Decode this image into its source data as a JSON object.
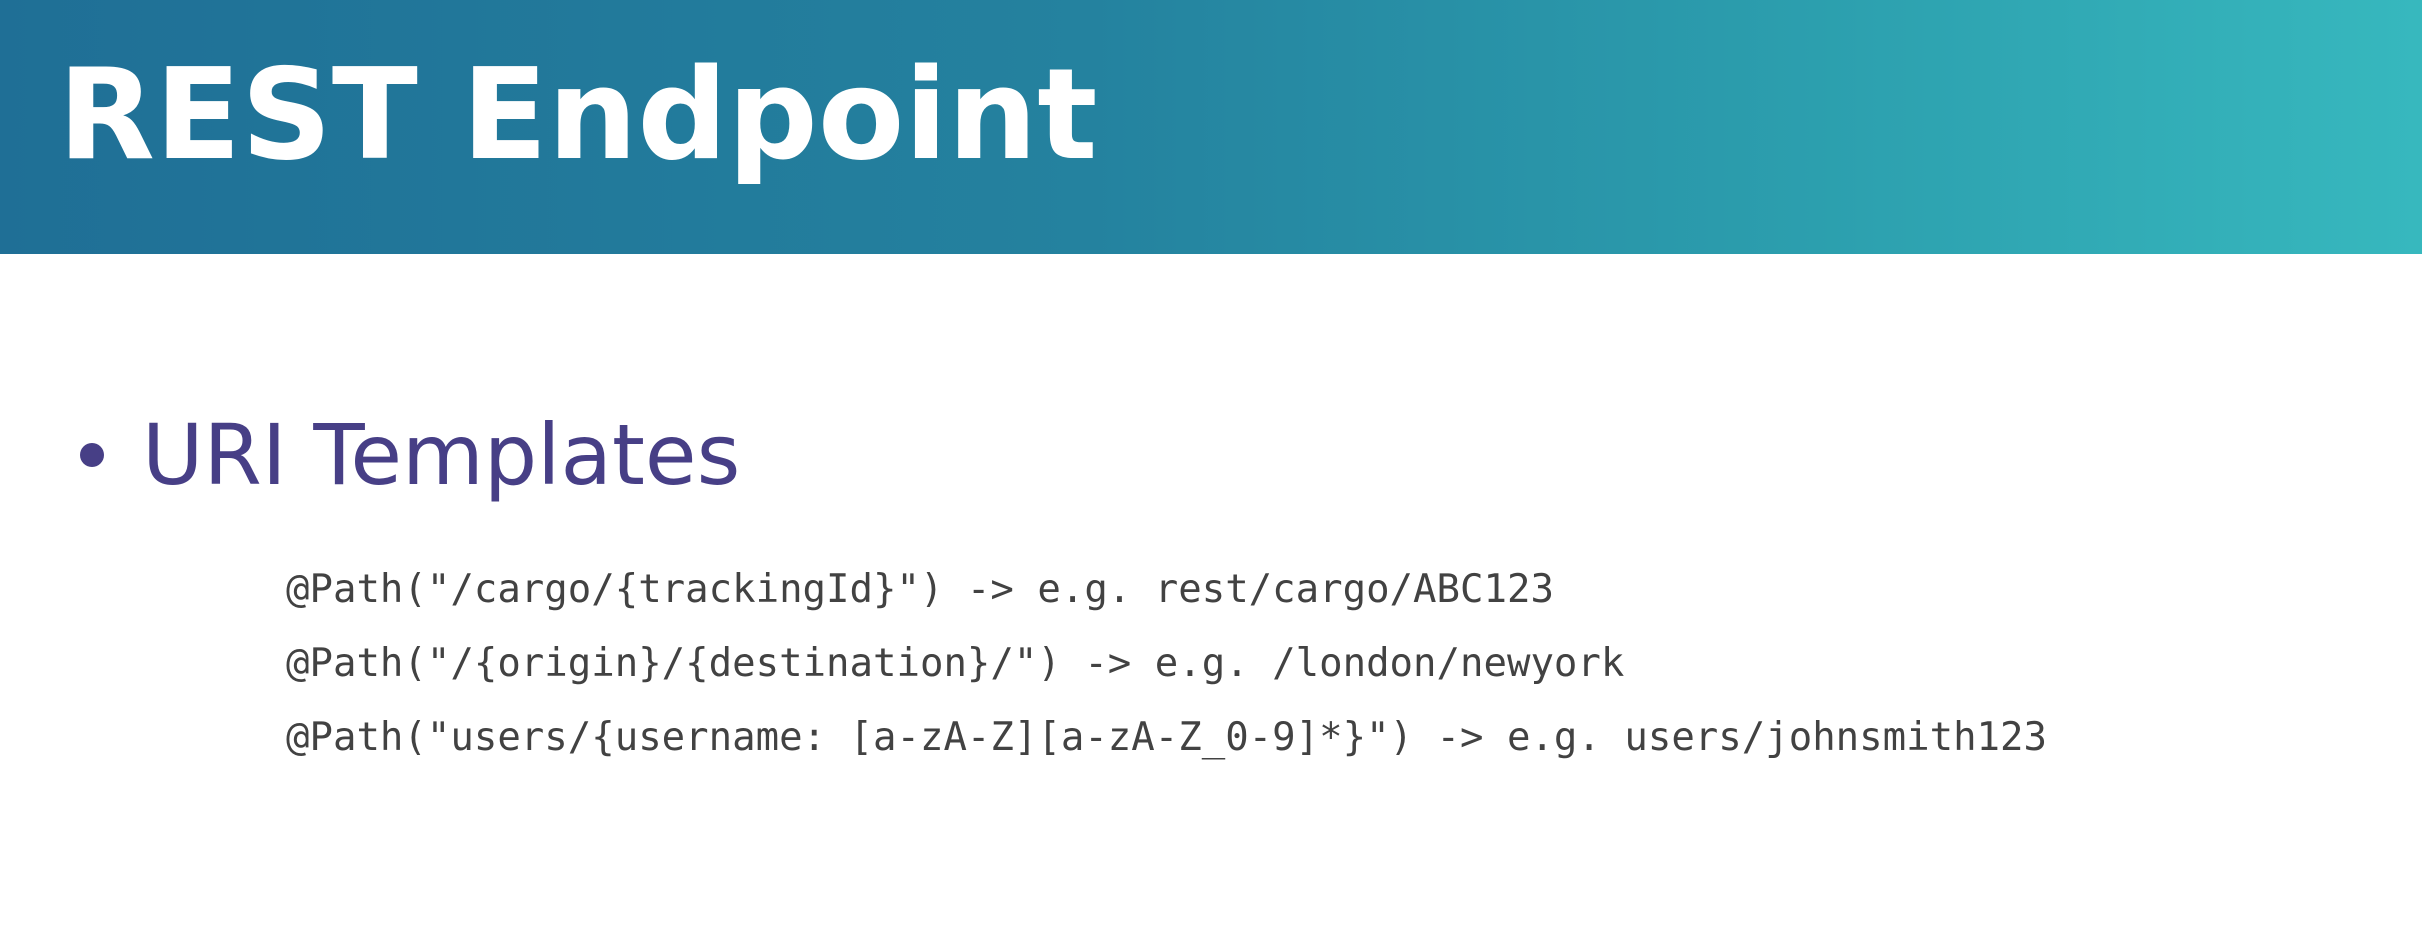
{
  "slide": {
    "title": "REST Endpoint",
    "bullet": "URI Templates",
    "code_lines": [
      "@Path(\"/cargo/{trackingId}\") -> e.g. rest/cargo/ABC123",
      "@Path(\"/{origin}/{destination}/\") -> e.g. /london/newyork",
      "@Path(\"users/{username: [a-zA-Z][a-zA-Z_0-9]*}\") -> e.g. users/johnsmith123"
    ]
  },
  "colors": {
    "header_start": "#1f6f96",
    "header_end": "#37b8be",
    "title_text": "#ffffff",
    "bullet_text": "#473f86",
    "code_text": "#424242",
    "background": "#ffffff"
  }
}
